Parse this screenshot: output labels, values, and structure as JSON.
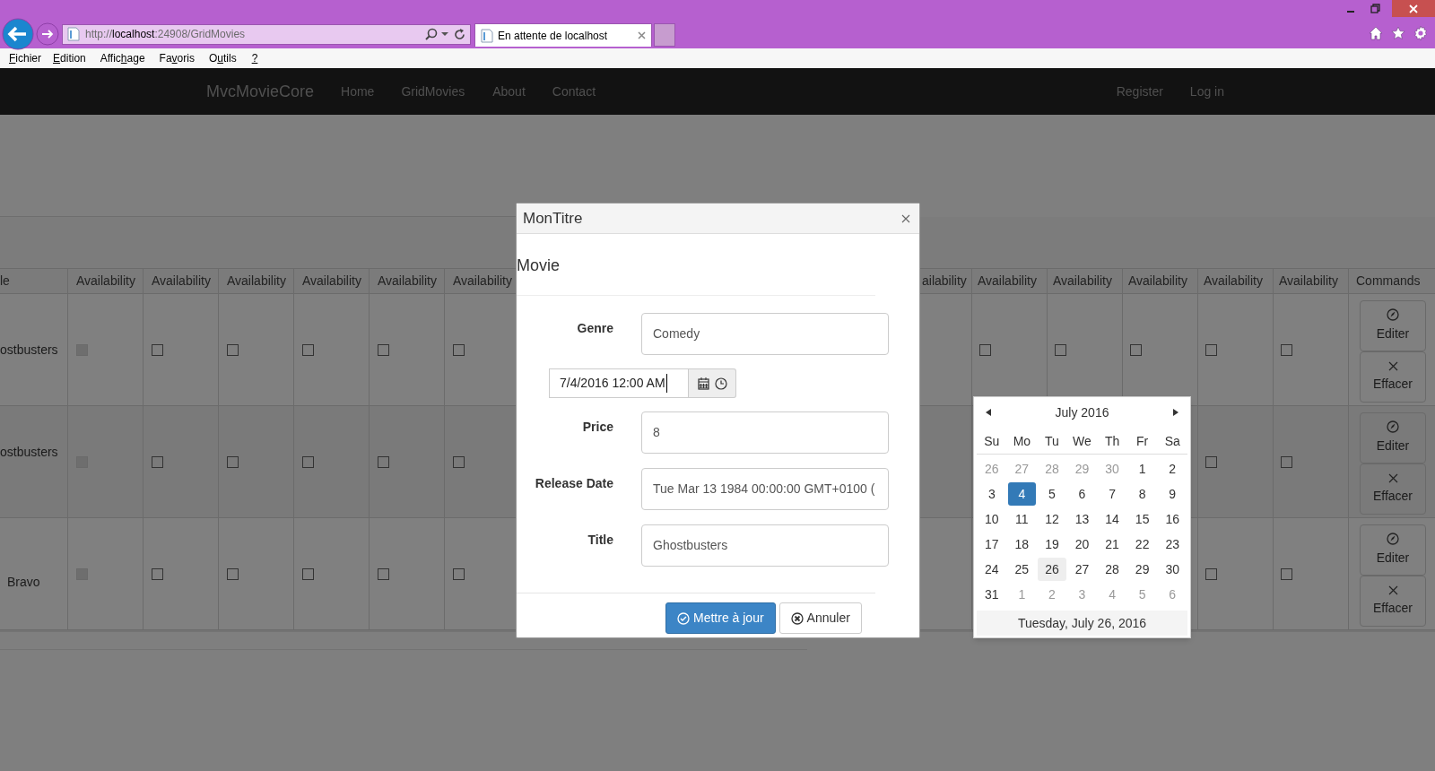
{
  "browser": {
    "url_scheme": "http://",
    "url_host": "localhost",
    "url_path": ":24908/GridMovies",
    "tab_title": "En attente de localhost"
  },
  "menu": [
    {
      "key": "F",
      "after": "ichier"
    },
    {
      "key": "E",
      "after": "dition"
    },
    {
      "before": "Affic",
      "key": "h",
      "after": "age"
    },
    {
      "before": "Fa",
      "key": "v",
      "after": "oris"
    },
    {
      "before": "O",
      "key": "u",
      "after": "tils"
    },
    {
      "key": "?"
    }
  ],
  "navbar": {
    "brand": "MvcMovieCore",
    "links": [
      "Home",
      "GridMovies",
      "About",
      "Contact"
    ],
    "right_links": [
      "Register",
      "Log in"
    ]
  },
  "grid": {
    "columns_left": [
      "le",
      "Availability",
      "Availability",
      "Availability",
      "Availability",
      "Availability",
      "Availability"
    ],
    "columns_right": [
      "ailability",
      "Availability",
      "Availability",
      "Availability",
      "Availability",
      "Availability",
      "Commands"
    ],
    "rows": [
      {
        "title": "ostbusters",
        "left_checkboxes": [
          {
            "checked": false,
            "disabled": true
          },
          {
            "checked": false,
            "disabled": false
          },
          {
            "checked": false,
            "disabled": false
          },
          {
            "checked": false,
            "disabled": false
          },
          {
            "checked": false,
            "disabled": false
          },
          {
            "checked": false,
            "disabled": false
          }
        ],
        "right_checkboxes": [
          {
            "checked": false,
            "disabled": false
          },
          {
            "checked": false,
            "disabled": false
          },
          {
            "checked": false,
            "disabled": false
          },
          {
            "checked": false,
            "disabled": false
          },
          {
            "checked": false,
            "disabled": false
          }
        ],
        "commands": [
          "Editer",
          "Effacer"
        ]
      },
      {
        "title": "ostbusters",
        "left_checkboxes": [
          {
            "checked": false,
            "disabled": true
          },
          {
            "checked": false,
            "disabled": false
          },
          {
            "checked": false,
            "disabled": false
          },
          {
            "checked": false,
            "disabled": false
          },
          {
            "checked": false,
            "disabled": false
          },
          {
            "checked": false,
            "disabled": false
          }
        ],
        "right_checkboxes": [
          {
            "checked": false,
            "disabled": false
          },
          {
            "checked": false,
            "disabled": false
          }
        ],
        "commands": [
          "Editer",
          "Effacer"
        ]
      },
      {
        "title": "Bravo",
        "left_checkboxes": [
          {
            "checked": false,
            "disabled": true
          },
          {
            "checked": false,
            "disabled": false
          },
          {
            "checked": false,
            "disabled": false
          },
          {
            "checked": false,
            "disabled": false
          },
          {
            "checked": false,
            "disabled": false
          },
          {
            "checked": false,
            "disabled": false
          }
        ],
        "right_checkboxes": [
          {
            "checked": false,
            "disabled": false
          },
          {
            "checked": false,
            "disabled": false
          }
        ],
        "commands": [
          "Editer",
          "Effacer"
        ]
      }
    ]
  },
  "dialog": {
    "title": "MonTitre",
    "heading": "Movie",
    "fields": [
      {
        "kind": "text",
        "label": "Genre",
        "value": "Comedy"
      },
      {
        "kind": "datetime",
        "value": "7/4/2016 12:00 AM"
      },
      {
        "kind": "text",
        "label": "Price",
        "value": "8"
      },
      {
        "kind": "text",
        "label": "Release Date",
        "value": "Tue Mar 13 1984 00:00:00 GMT+0100 ("
      },
      {
        "kind": "text",
        "label": "Title",
        "value": "Ghostbusters"
      }
    ],
    "buttons": [
      {
        "kind": "primary",
        "label": "Mettre à jour"
      },
      {
        "kind": "default",
        "label": "Annuler"
      }
    ]
  },
  "calendar": {
    "month": "July 2016",
    "weekdays": [
      "Su",
      "Mo",
      "Tu",
      "We",
      "Th",
      "Fr",
      "Sa"
    ],
    "weeks": [
      [
        {
          "day": "26",
          "other_month": true,
          "selected": false,
          "today": false
        },
        {
          "day": "27",
          "other_month": true,
          "selected": false,
          "today": false
        },
        {
          "day": "28",
          "other_month": true,
          "selected": false,
          "today": false
        },
        {
          "day": "29",
          "other_month": true,
          "selected": false,
          "today": false
        },
        {
          "day": "30",
          "other_month": true,
          "selected": false,
          "today": false
        },
        {
          "day": "1",
          "other_month": false,
          "selected": false,
          "today": false
        },
        {
          "day": "2",
          "other_month": false,
          "selected": false,
          "today": false
        }
      ],
      [
        {
          "day": "3",
          "other_month": false,
          "selected": false,
          "today": false
        },
        {
          "day": "4",
          "other_month": false,
          "selected": true,
          "today": false
        },
        {
          "day": "5",
          "other_month": false,
          "selected": false,
          "today": false
        },
        {
          "day": "6",
          "other_month": false,
          "selected": false,
          "today": false
        },
        {
          "day": "7",
          "other_month": false,
          "selected": false,
          "today": false
        },
        {
          "day": "8",
          "other_month": false,
          "selected": false,
          "today": false
        },
        {
          "day": "9",
          "other_month": false,
          "selected": false,
          "today": false
        }
      ],
      [
        {
          "day": "10",
          "other_month": false,
          "selected": false,
          "today": false
        },
        {
          "day": "11",
          "other_month": false,
          "selected": false,
          "today": false
        },
        {
          "day": "12",
          "other_month": false,
          "selected": false,
          "today": false
        },
        {
          "day": "13",
          "other_month": false,
          "selected": false,
          "today": false
        },
        {
          "day": "14",
          "other_month": false,
          "selected": false,
          "today": false
        },
        {
          "day": "15",
          "other_month": false,
          "selected": false,
          "today": false
        },
        {
          "day": "16",
          "other_month": false,
          "selected": false,
          "today": false
        }
      ],
      [
        {
          "day": "17",
          "other_month": false,
          "selected": false,
          "today": false
        },
        {
          "day": "18",
          "other_month": false,
          "selected": false,
          "today": false
        },
        {
          "day": "19",
          "other_month": false,
          "selected": false,
          "today": false
        },
        {
          "day": "20",
          "other_month": false,
          "selected": false,
          "today": false
        },
        {
          "day": "21",
          "other_month": false,
          "selected": false,
          "today": false
        },
        {
          "day": "22",
          "other_month": false,
          "selected": false,
          "today": false
        },
        {
          "day": "23",
          "other_month": false,
          "selected": false,
          "today": false
        }
      ],
      [
        {
          "day": "24",
          "other_month": false,
          "selected": false,
          "today": false
        },
        {
          "day": "25",
          "other_month": false,
          "selected": false,
          "today": false
        },
        {
          "day": "26",
          "other_month": false,
          "selected": false,
          "today": true
        },
        {
          "day": "27",
          "other_month": false,
          "selected": false,
          "today": false
        },
        {
          "day": "28",
          "other_month": false,
          "selected": false,
          "today": false
        },
        {
          "day": "29",
          "other_month": false,
          "selected": false,
          "today": false
        },
        {
          "day": "30",
          "other_month": false,
          "selected": false,
          "today": false
        }
      ],
      [
        {
          "day": "31",
          "other_month": false,
          "selected": false,
          "today": false
        },
        {
          "day": "1",
          "other_month": true,
          "selected": false,
          "today": false
        },
        {
          "day": "2",
          "other_month": true,
          "selected": false,
          "today": false
        },
        {
          "day": "3",
          "other_month": true,
          "selected": false,
          "today": false
        },
        {
          "day": "4",
          "other_month": true,
          "selected": false,
          "today": false
        },
        {
          "day": "5",
          "other_month": true,
          "selected": false,
          "today": false
        },
        {
          "day": "6",
          "other_month": true,
          "selected": false,
          "today": false
        }
      ]
    ],
    "footer": "Tuesday, July 26, 2016"
  }
}
